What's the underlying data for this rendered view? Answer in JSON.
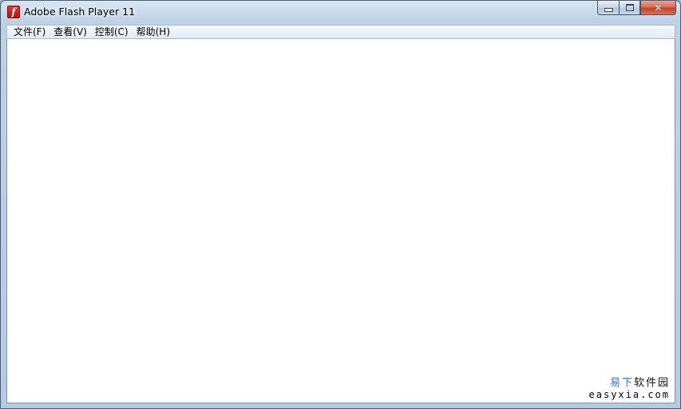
{
  "window": {
    "title": "Adobe Flash Player 11",
    "icon": "flash-f-icon",
    "icon_glyph": "f",
    "controls": {
      "minimize": "minimize-icon",
      "maximize": "maximize-icon",
      "close": "close-icon",
      "close_glyph": "✕"
    }
  },
  "menu": {
    "items": [
      {
        "label": "文件(F)"
      },
      {
        "label": "查看(V)"
      },
      {
        "label": "控制(C)"
      },
      {
        "label": "帮助(H)"
      }
    ]
  },
  "watermark": {
    "brand_part1": "易下",
    "brand_part2": "软件园",
    "url": "easyxia.com",
    "colors": {
      "accent": "#2f6fd6",
      "text": "#111111"
    }
  },
  "colors": {
    "frame": "#bdd1e6",
    "close_button": "#c4401f",
    "content_background": "#ffffff"
  }
}
